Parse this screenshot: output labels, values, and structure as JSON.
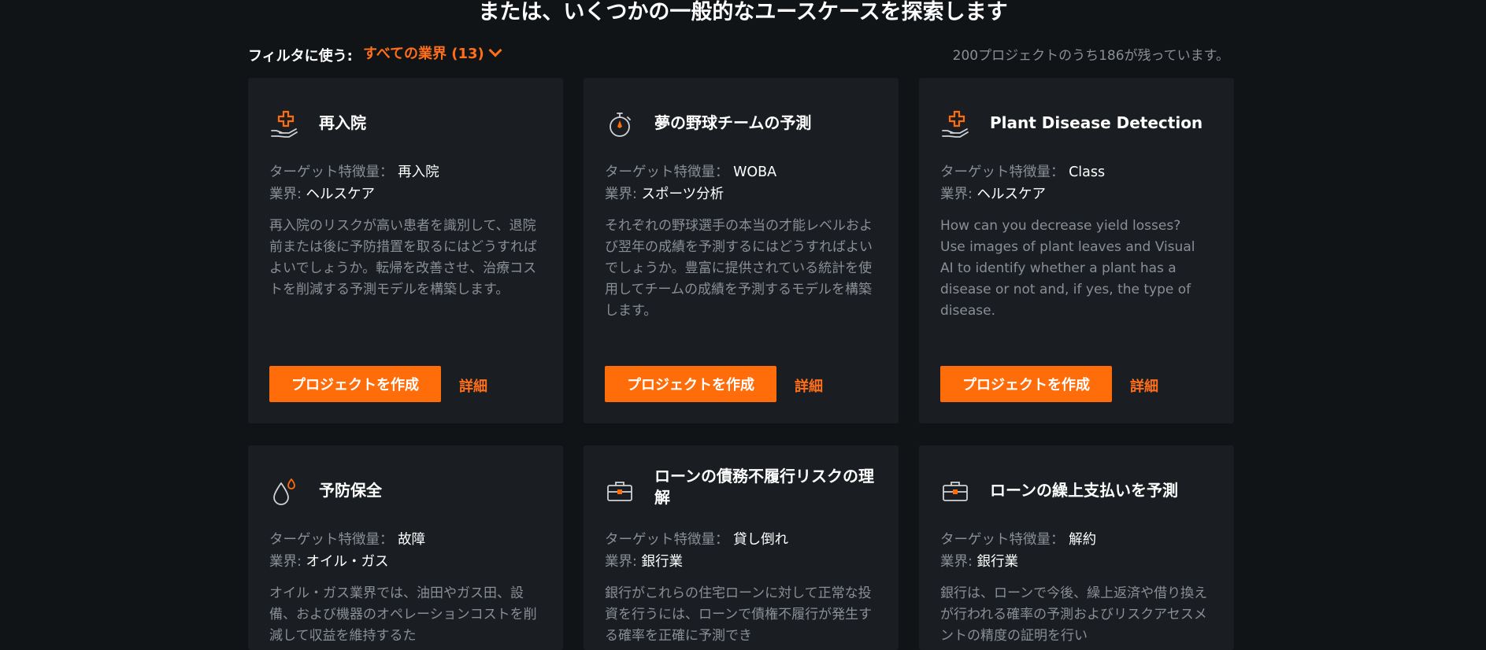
{
  "heading": "または、いくつかの一般的なユースケースを探索します",
  "filter": {
    "label": "フィルタに使う:",
    "selected": "すべての業界 (13)"
  },
  "remaining": "200プロジェクトのうち186が残っています。",
  "labels": {
    "target": "ターゲット特徴量：",
    "industry": "業界:",
    "create": "プロジェクトを作成",
    "details": "詳細"
  },
  "colors": {
    "accent": "#ff6c0a",
    "background": "#111417",
    "card": "#1a1e22",
    "muted_text": "#8a8f95"
  },
  "cards": [
    {
      "icon": "hand-medical-cross-icon",
      "title": "再入院",
      "target": "再入院",
      "industry": "ヘルスケア",
      "description": "再入院のリスクが高い患者を識別して、退院前または後に予防措置を取るにはどうすればよいでしょうか。転帰を改善させ、治療コストを削減する予測モデルを構築します。"
    },
    {
      "icon": "stopwatch-icon",
      "title": "夢の野球チームの予測",
      "target": "WOBA",
      "industry": "スポーツ分析",
      "description": "それぞれの野球選手の本当の才能レベルおよび翌年の成績を予測するにはどうすればよいでしょうか。豊富に提供されている統計を使用してチームの成績を予測するモデルを構築します。"
    },
    {
      "icon": "hand-medical-cross-icon",
      "title": "Plant Disease Detection",
      "target": "Class",
      "industry": "ヘルスケア",
      "description": "How can you decrease yield losses? Use images of plant leaves and Visual AI to identify whether a plant has a disease or not and, if yes, the type of disease."
    },
    {
      "icon": "oil-drops-icon",
      "title": "予防保全",
      "target": "故障",
      "industry": "オイル・ガス",
      "description": "オイル・ガス業界では、油田やガス田、設備、および機器のオペレーションコストを削減して収益を維持するた"
    },
    {
      "icon": "briefcase-icon",
      "title": "ローンの債務不履行リスクの理解",
      "target": "貸し倒れ",
      "industry": "銀行業",
      "description": "銀行がこれらの住宅ローンに対して正常な投資を行うには、ローンで債権不履行が発生する確率を正確に予測でき"
    },
    {
      "icon": "briefcase-icon",
      "title": "ローンの繰上支払いを予測",
      "target": "解約",
      "industry": "銀行業",
      "description": "銀行は、ローンで今後、繰上返済や借り換えが行われる確率の予測およびリスクアセスメントの精度の証明を行い"
    }
  ]
}
